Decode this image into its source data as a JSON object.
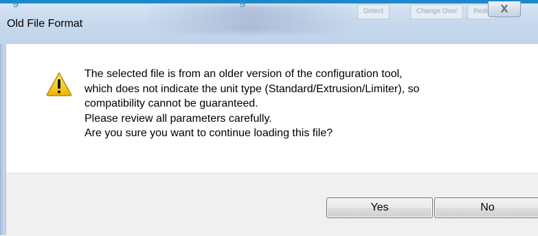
{
  "dialog": {
    "title": "Old File Format",
    "close_symbol": "X",
    "icon": "warning-icon",
    "message_lines": [
      "The selected file is from an older version of the configuration tool,",
      "which does not indicate the unit type (Standard/Extrusion/Limiter), so",
      "compatibility cannot be guaranteed.",
      "Please review all parameters carefully.",
      "Are you sure you want to continue loading this file?"
    ],
    "buttons": {
      "yes": "Yes",
      "no": "No"
    }
  },
  "background_window": {
    "text_fragments": [
      "g",
      "g"
    ],
    "tabs": [
      "Detect",
      "Change Over",
      "Redo"
    ]
  },
  "colors": {
    "accent_blue": "#1c88c9",
    "warning_yellow": "#f5c518",
    "footer_bg": "#f0f0f0"
  }
}
